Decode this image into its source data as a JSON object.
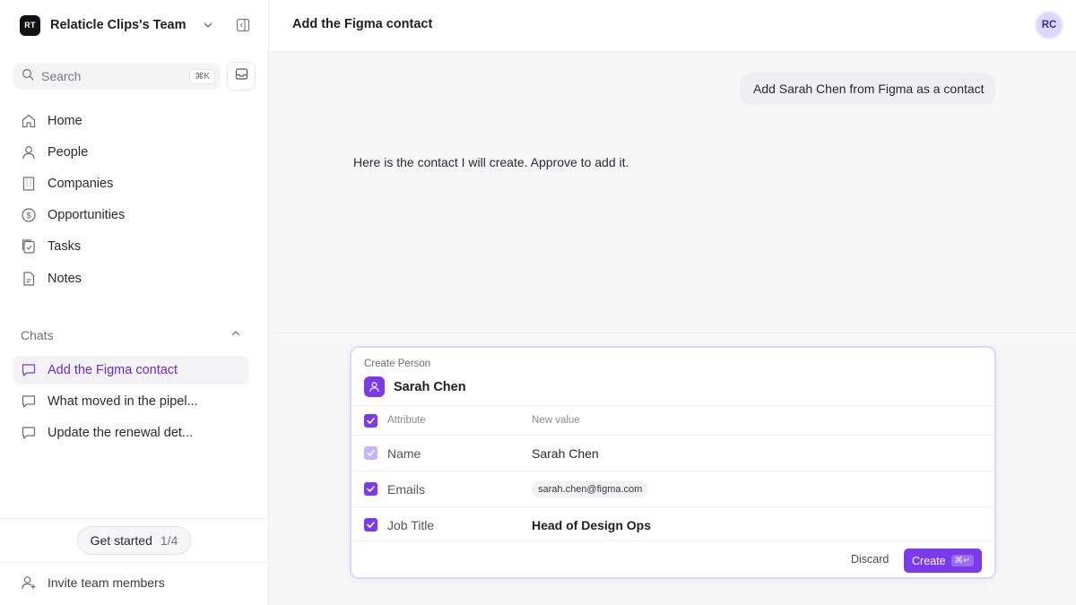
{
  "sidebar": {
    "team": {
      "badge": "RT",
      "name": "Relaticle Clips's Team"
    },
    "search": {
      "placeholder": "Search",
      "shortcut": "⌘K"
    },
    "nav": [
      {
        "label": "Home",
        "icon": "home-icon"
      },
      {
        "label": "People",
        "icon": "user-icon"
      },
      {
        "label": "Companies",
        "icon": "building-icon"
      },
      {
        "label": "Opportunities",
        "icon": "dollar-circle-icon"
      },
      {
        "label": "Tasks",
        "icon": "tasks-icon"
      },
      {
        "label": "Notes",
        "icon": "note-icon"
      }
    ],
    "chats": {
      "title": "Chats",
      "items": [
        {
          "label": "Add the Figma contact",
          "active": true
        },
        {
          "label": "What moved in the pipel...",
          "active": false
        },
        {
          "label": "Update the renewal det...",
          "active": false
        }
      ]
    },
    "get_started": {
      "label": "Get started",
      "progress": "1/4"
    },
    "invite": {
      "label": "Invite team members"
    }
  },
  "header": {
    "title": "Add the Figma contact",
    "avatar_initials": "RC"
  },
  "conversation": {
    "user_message": "Add Sarah Chen from Figma as a contact",
    "assistant_message": "Here is the contact I will create. Approve to add it."
  },
  "card": {
    "kicker": "Create Person",
    "person_name": "Sarah Chen",
    "columns": {
      "attribute": "Attribute",
      "new_value": "New value"
    },
    "rows": [
      {
        "attribute": "Name",
        "value": "Sarah Chen",
        "checked": true
      },
      {
        "attribute": "Emails",
        "value": "sarah.chen@figma.com",
        "checked": true
      },
      {
        "attribute": "Job Title",
        "value": "Head of Design Ops",
        "checked": true
      }
    ],
    "discard_label": "Discard",
    "create_label": "Create",
    "create_shortcut": "⌘↵"
  },
  "colors": {
    "accent": "#7c3aed",
    "accent_soft": "#ddd6fe",
    "active_text": "#6d28d9"
  }
}
